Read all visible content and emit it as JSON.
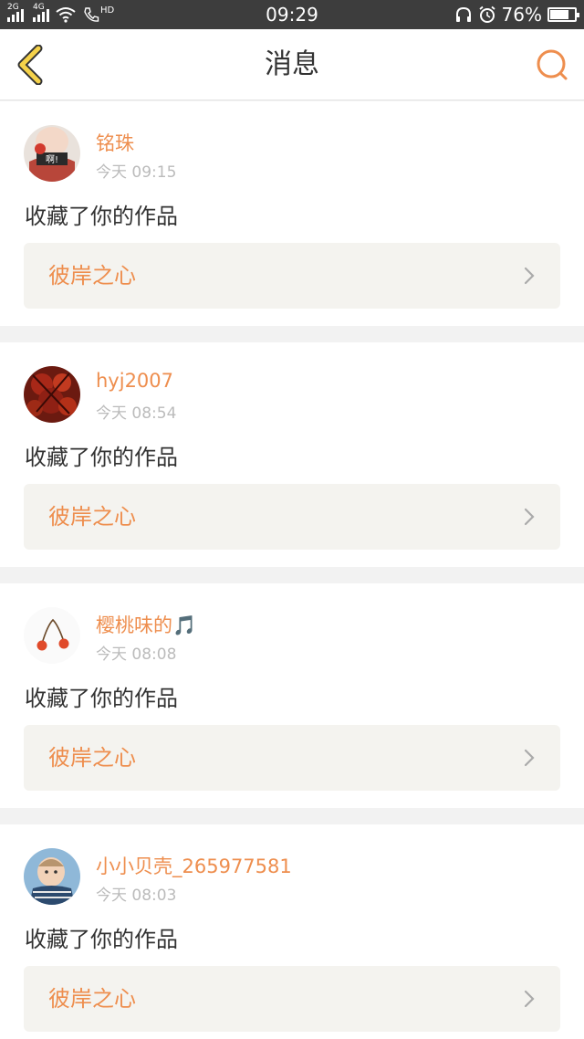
{
  "status_bar": {
    "net_1": "2G",
    "net_2": "4G",
    "hd": "HD",
    "time": "09:29",
    "battery_percent": "76%",
    "battery_level": 0.76
  },
  "header": {
    "title": "消息",
    "back_icon": "chevron-left-icon",
    "search_icon": "search-icon"
  },
  "colors": {
    "accent": "#ee8e4e",
    "back_arrow": "#f5d24a",
    "card_bg": "#ffffff",
    "link_bg": "#f4f3ef"
  },
  "messages": [
    {
      "username": "铭珠",
      "time": "今天 09:15",
      "action": "收藏了你的作品",
      "work_title": "彼岸之心",
      "avatar_text": "啊!"
    },
    {
      "username": "hyj2007",
      "time": "今天 08:54",
      "action": "收藏了你的作品",
      "work_title": "彼岸之心"
    },
    {
      "username": "樱桃味的🎵",
      "time": "今天 08:08",
      "action": "收藏了你的作品",
      "work_title": "彼岸之心"
    },
    {
      "username": "小小贝壳_265977581",
      "time": "今天 08:03",
      "action": "收藏了你的作品",
      "work_title": "彼岸之心"
    }
  ]
}
